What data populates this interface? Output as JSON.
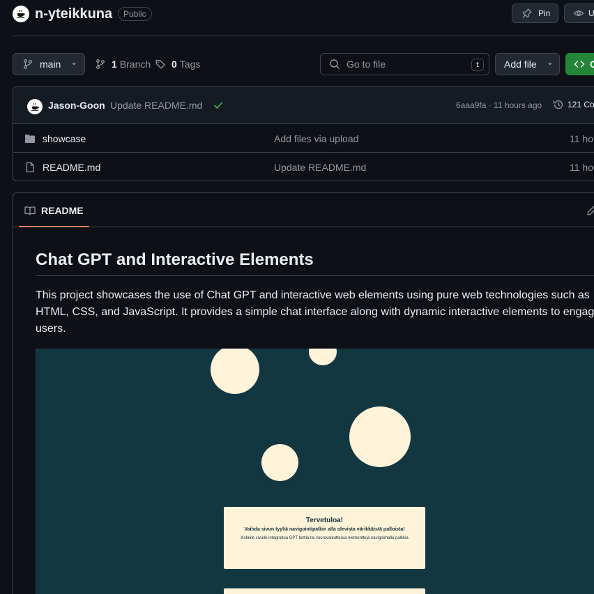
{
  "repo": {
    "name": "n-yteikkuna",
    "visibility": "Public",
    "pin_label": "Pin",
    "watch_label": "Un"
  },
  "toolbar": {
    "branch": "main",
    "branch_count": "1",
    "branch_label": "Branch",
    "tag_count": "0",
    "tag_label": "Tags",
    "goto_placeholder": "Go to file",
    "goto_shortcut": "t",
    "add_file_label": "Add file",
    "code_label": "C"
  },
  "commit": {
    "author": "Jason-Goon",
    "message": "Update README.md",
    "hash_time": "6aaa9fa · 11 hours ago",
    "history": "121 Co"
  },
  "files": [
    {
      "name": "showcase",
      "type": "folder",
      "message": "Add files via upload",
      "age": "11 hou"
    },
    {
      "name": "README.md",
      "type": "file",
      "message": "Update README.md",
      "age": "11 hou"
    }
  ],
  "readme": {
    "tab_label": "README",
    "heading": "Chat GPT and Interactive Elements",
    "body": "This project showcases the use of Chat GPT and interactive web elements using pure web technologies such as HTML, CSS, and JavaScript. It provides a simple chat interface along with dynamic interactive elements to engag users."
  },
  "preview": {
    "welcome_title": "Tervetuloa!",
    "welcome_subtitle": "Vaihda sivun tyyliä navigointipalkin alla olevista värikkäistä palloista!",
    "welcome_hint": "Kokeile sivulle integroitua GPT bottia tai vuorovaikutteisia elementtejä navigoimalla palkkia"
  },
  "colors": {
    "page_bg": "#0d1117",
    "accent_green": "#238636",
    "tab_underline": "#f78166",
    "preview_bg": "#133740",
    "preview_ball": "#fff3da"
  }
}
